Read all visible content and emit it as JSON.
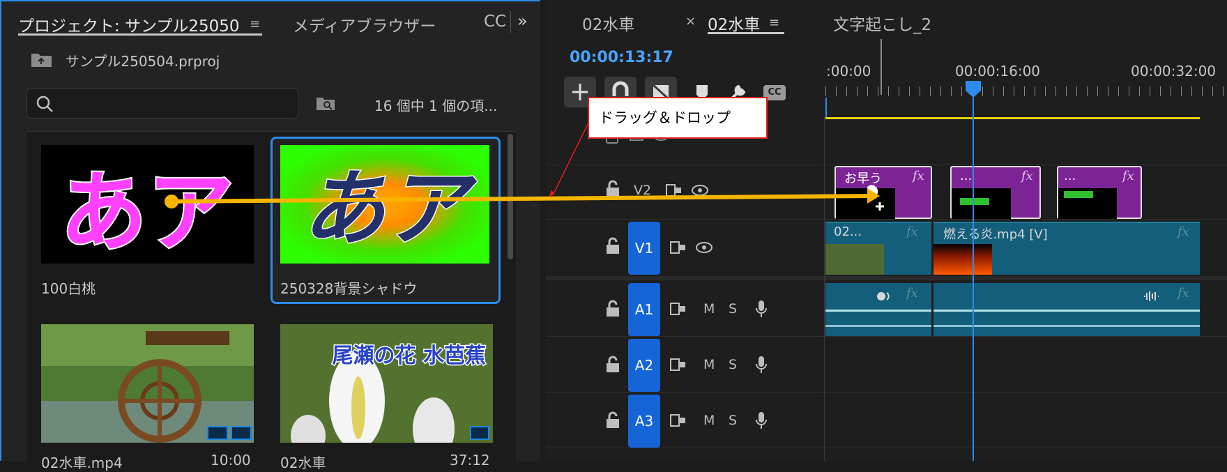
{
  "project_panel": {
    "tabs": [
      {
        "label": "プロジェクト: サンプル25050"
      },
      {
        "label": "メディアブラウザー"
      },
      {
        "label": "CC"
      }
    ],
    "project_file": "サンプル250504.prproj",
    "search": {
      "placeholder": "",
      "value": ""
    },
    "item_count": "16 個中 1 個の項...",
    "items": [
      {
        "name": "100白桃",
        "thumb_text": "あア",
        "duration": ""
      },
      {
        "name": "250328背景シャドウ",
        "thumb_text": "あア",
        "duration": ""
      },
      {
        "name": "02水車.mp4",
        "thumb_text": "",
        "duration": "10:00"
      },
      {
        "name": "02水車",
        "thumb_text": "尾瀬の花 水芭蕉",
        "duration": "37:12"
      }
    ]
  },
  "timeline": {
    "tabs": [
      {
        "label": "02水車"
      },
      {
        "label": "02水車"
      },
      {
        "label": "文字起こし_2"
      }
    ],
    "close_glyph": "×",
    "timecode": "00:00:13:17",
    "ruler_labels": [
      ":00:00",
      "00:00:16:00",
      "00:00:32:00"
    ],
    "tools": {
      "cc_label": "CC"
    },
    "tracks": [
      {
        "label": "V2"
      },
      {
        "label": "V1"
      },
      {
        "label": "A1",
        "m": "M",
        "s": "S"
      },
      {
        "label": "A2",
        "m": "M",
        "s": "S"
      },
      {
        "label": "A3",
        "m": "M",
        "s": "S"
      }
    ],
    "clips": {
      "v2": [
        {
          "name": "お早う",
          "fx": "fx"
        },
        {
          "name": "...",
          "fx": "fx"
        },
        {
          "name": "...",
          "fx": "fx"
        }
      ],
      "v1": [
        {
          "name": "02...",
          "fx": "fx"
        },
        {
          "name": "燃える炎.mp4 [V]",
          "fx": "fx"
        }
      ],
      "a1": [
        {
          "fx": "fx"
        },
        {
          "fx": "fx"
        }
      ]
    }
  },
  "annotation": {
    "callout": "ドラッグ＆ドロップ"
  },
  "colors": {
    "accent": "#2d8ceb",
    "track_blue": "#1565d8",
    "clip_purple": "#7c2395",
    "clip_teal": "#135e7a",
    "arrow": "#f5b400",
    "callout_border": "#e02020"
  }
}
